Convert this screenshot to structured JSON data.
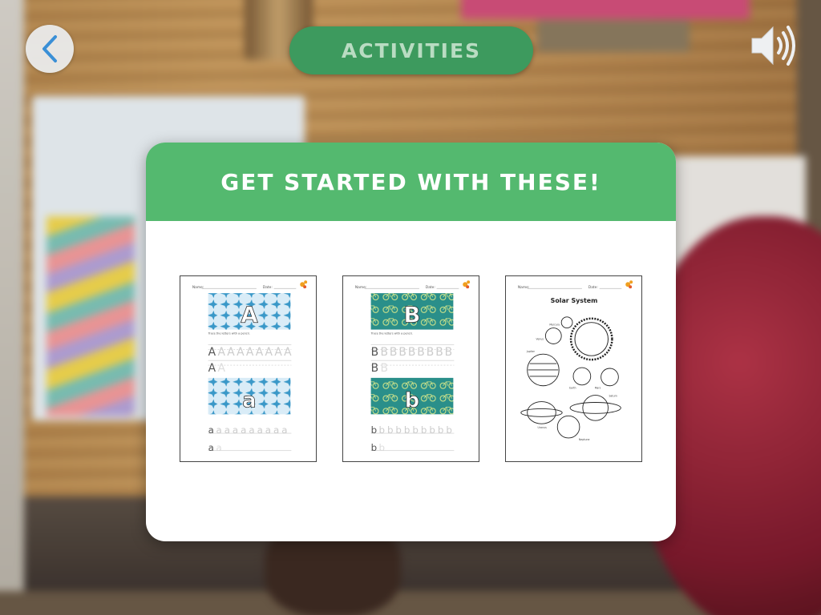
{
  "header": {
    "title": "ACTIVITIES",
    "back_icon": "chevron-left-icon",
    "sound_icon": "speaker-volume-icon"
  },
  "modal": {
    "heading": "GET STARTED WITH THESE!",
    "worksheets": [
      {
        "name_label": "Name:",
        "date_label": "Date:",
        "big_letter": "A",
        "small_letter": "a",
        "instruction": "Trace the letters with a pencil.",
        "pattern": "airplanes",
        "pattern_color": "#3a98c8"
      },
      {
        "name_label": "Name:",
        "date_label": "Date:",
        "big_letter": "B",
        "small_letter": "b",
        "instruction": "Trace the letters with a pencil.",
        "pattern": "bicycles",
        "pattern_color": "#2a8f8a"
      },
      {
        "name_label": "Name:",
        "date_label": "Date:",
        "title": "Solar System",
        "planet_labels": [
          "Mercury",
          "Venus",
          "Jupiter",
          "Earth",
          "Mars",
          "Saturn",
          "Uranus",
          "Neptune"
        ]
      }
    ]
  },
  "colors": {
    "title_pill": "#3d9a5e",
    "title_text": "#b9dcc2",
    "modal_header": "#54b96f",
    "back_chevron": "#3a8fd6"
  }
}
